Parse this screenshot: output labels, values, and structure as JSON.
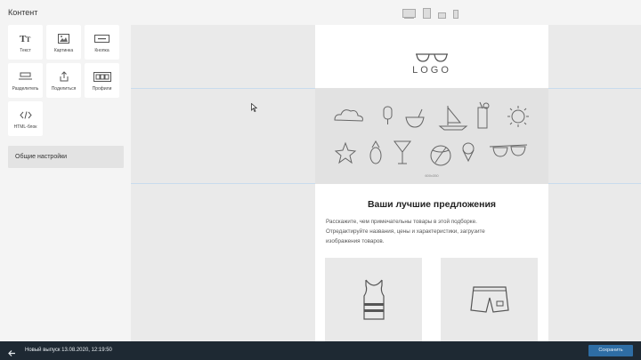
{
  "panel": {
    "title": "Контент",
    "blocks": [
      {
        "label": "Текст",
        "icon": "text-icon"
      },
      {
        "label": "Картинка",
        "icon": "image-icon"
      },
      {
        "label": "Кнопка",
        "icon": "button-icon"
      },
      {
        "label": "Разделитель",
        "icon": "divider-icon"
      },
      {
        "label": "Поделиться",
        "icon": "share-icon"
      },
      {
        "label": "Профили",
        "icon": "social-profiles-icon"
      },
      {
        "label": "HTML-блок",
        "icon": "code-icon"
      }
    ],
    "general_settings": "Общие настройки"
  },
  "devices": [
    "desktop-icon",
    "tablet-icon",
    "tablet-landscape-icon",
    "mobile-icon"
  ],
  "email": {
    "logo": "LOGO",
    "hero_caption": "600x350",
    "headline": "Ваши лучшие предложения",
    "body": "Расскажите, чем примечательны товары в этой подборке. Отредактируйте названия, цены и характеристики, загрузите изображения товаров."
  },
  "footer": {
    "issue": "Новый выпуск 13.08.2020, 12:19:50",
    "save": "Сохранить"
  },
  "colors": {
    "bottom_bar": "#1e2933",
    "save_button": "#2e6da4",
    "selection": "#c8dcee"
  }
}
